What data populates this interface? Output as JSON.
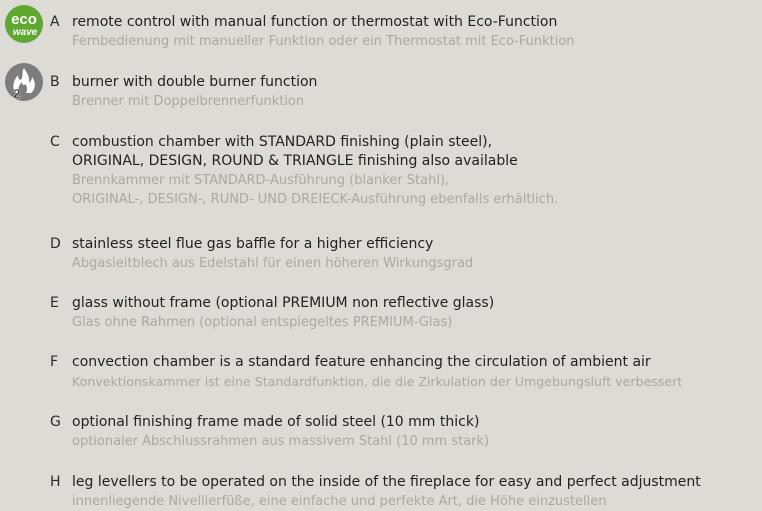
{
  "badges": {
    "eco": {
      "top_text": "eco",
      "bottom_text": "wave",
      "color": "#5fa82f"
    },
    "double_burner": {
      "number": "2",
      "color": "#7a7a7a"
    }
  },
  "items": [
    {
      "letter": "A",
      "en": "remote control with manual function or thermostat with Eco-Function",
      "de": "Fernbedienung mit manueller Funktion oder ein Thermostat mit Eco-Funktion"
    },
    {
      "letter": "B",
      "en": "burner with double burner function",
      "de": "Brenner mit Doppelbrennerfunktion"
    },
    {
      "letter": "C",
      "en": "combustion chamber with STANDARD finishing (plain steel),",
      "en2": "ORIGINAL, DESIGN, ROUND & TRIANGLE finishing also available",
      "de": "Brennkammer mit STANDARD-Ausführung (blanker Stahl),",
      "de2": "ORIGINAL-, DESIGN-, RUND- UND DREIECK-Ausführung ebenfalls erhältlich."
    },
    {
      "letter": "D",
      "en": "stainless steel flue gas baffle for a higher efficiency",
      "de": "Abgasleitblech aus Edelstahl für einen höheren Wirkungsgrad"
    },
    {
      "letter": "E",
      "en": "glass without frame (optional PREMIUM non reflective glass)",
      "de": "Glas ohne Rahmen (optional entspiegeltes PREMIUM-Glas)"
    },
    {
      "letter": "F",
      "en": "convection chamber is a standard feature enhancing the circulation of ambient air",
      "de": "Konvektionskammer ist eine Standardfunktion, die die Zirkulation der Umgebungsluft verbessert"
    },
    {
      "letter": "G",
      "en": "optional finishing frame made of solid steel (10 mm thick)",
      "de": "optionaler Abschlussrahmen aus massivem Stahl (10 mm stark)"
    },
    {
      "letter": "H",
      "en": "leg levellers to be operated on the inside of the fireplace for easy and perfect adjustment",
      "de": "innenliegende Nivellierfüße, eine einfache und perfekte Art, die Höhe einzustellen"
    }
  ]
}
